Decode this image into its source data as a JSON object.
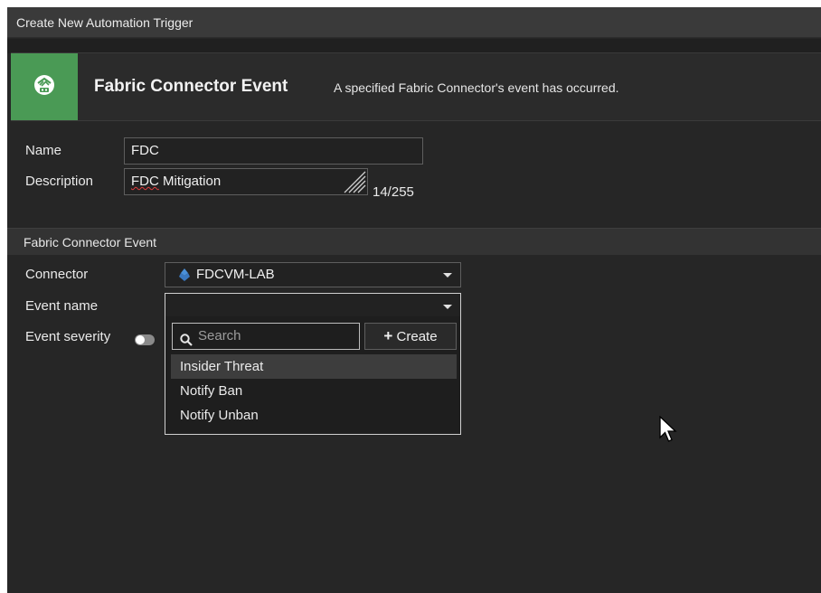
{
  "window": {
    "title": "Create New Automation Trigger"
  },
  "trigger": {
    "icon": "fabric-connector-icon",
    "title": "Fabric Connector Event",
    "description": "A specified Fabric Connector's event has occurred.",
    "accent": "#4a9a55"
  },
  "form": {
    "name_label": "Name",
    "name_value": "FDC",
    "description_label": "Description",
    "description_value_part1": "FDC",
    "description_value_part2": " Mitigation",
    "char_counter": "14/255"
  },
  "section": {
    "title": "Fabric Connector Event",
    "connector_label": "Connector",
    "connector_value": "FDCVM-LAB",
    "connector_icon_color": "#4a90d9",
    "event_name_label": "Event name",
    "event_name_value": "",
    "event_severity_label": "Event severity"
  },
  "dropdown": {
    "search_placeholder": "Search",
    "create_label": "Create",
    "options": [
      "Insider Threat",
      "Notify Ban",
      "Notify Unban"
    ],
    "highlighted_index": 0
  }
}
